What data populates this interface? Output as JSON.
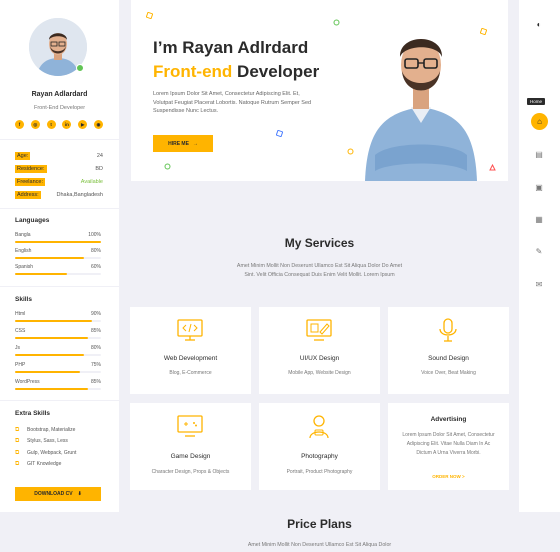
{
  "profile": {
    "name": "Rayan Adlardard",
    "role": "Front-End Developer",
    "socials": [
      "facebook-icon",
      "instagram-icon",
      "twitter-icon",
      "linkedin-icon",
      "youtube-icon",
      "dribbble-icon"
    ],
    "info": [
      {
        "key": "Age:",
        "value": "24",
        "status": ""
      },
      {
        "key": "Residence:",
        "value": "BD",
        "status": ""
      },
      {
        "key": "Freelance:",
        "value": "Available",
        "status": "green"
      },
      {
        "key": "Address:",
        "value": "Dhaka,Bangladesh",
        "status": ""
      }
    ]
  },
  "languages": {
    "title": "Languages",
    "items": [
      {
        "label": "Bangla",
        "value": "100%",
        "percent": 100
      },
      {
        "label": "English",
        "value": "80%",
        "percent": 80
      },
      {
        "label": "Spanish",
        "value": "60%",
        "percent": 60
      }
    ]
  },
  "skills": {
    "title": "Skills",
    "items": [
      {
        "label": "Html",
        "value": "90%",
        "percent": 90
      },
      {
        "label": "CSS",
        "value": "85%",
        "percent": 85
      },
      {
        "label": "Js",
        "value": "80%",
        "percent": 80
      },
      {
        "label": "PHP",
        "value": "75%",
        "percent": 75
      },
      {
        "label": "WordPress",
        "value": "85%",
        "percent": 85
      }
    ]
  },
  "extra_skills": {
    "title": "Extra Skills",
    "items": [
      "Bootstrap, Materialize",
      "Stylus, Sass, Less",
      "Gulp, Webpack, Grunt",
      "GIT Knowledge"
    ]
  },
  "download_cv": "DOWNLOAD CV",
  "hero": {
    "line1": "I’m Rayan Adlrdard",
    "line2_accent": "Front-end",
    "line2_rest": " Developer",
    "paragraph": "Lorem Ipsum Dolor Sit Amet, Consectetur Adipiscing Elit. Et, Volutpat Feugiat Placerat Lobortis. Natoque Rutrum Semper Sed Suspendisse Nunc Lectus.",
    "hire_label": "HIRE ME"
  },
  "rail": {
    "tooltip": "Home",
    "icons": [
      "theme-toggle-icon",
      "home-icon",
      "resume-icon",
      "profile-icon",
      "portfolio-icon",
      "blog-icon",
      "contact-icon"
    ]
  },
  "services": {
    "title": "My Services",
    "subtitle": "Amet Minim Mollit Non Deserunt Ullamco Est Sit Aliqua Dolor Do Amet Sint. Velit Officia Consequat Duis Enim Velit Mollit. Lorem Ipsum",
    "cards": [
      {
        "title": "Web Development",
        "sub": "Blog, E-Commerce",
        "icon": "web-development-icon"
      },
      {
        "title": "UI/UX Design",
        "sub": "Mobile App, Website Design",
        "icon": "ui-ux-design-icon"
      },
      {
        "title": "Sound Design",
        "sub": "Voice Over, Beat Making",
        "icon": "microphone-icon"
      },
      {
        "title": "Game Design",
        "sub": "Character Design, Props & Objects",
        "icon": "game-design-icon"
      },
      {
        "title": "Photography",
        "sub": "Portrait, Product Photography",
        "icon": "photography-icon"
      }
    ],
    "advertising": {
      "title": "Advertising",
      "text": "Lorem Ipsum Dolor Sit Amet, Consectetur Adipiscing Elit. Vitae Nulla Diam In Ac Dictum A Urna Viverra Morbi.",
      "link": "ORDER NOW >"
    }
  },
  "price": {
    "title": "Price Plans",
    "subtitle": "Amet Minim Mollit Non Deserunt Ullamco Est Sit Aliqua Dolor"
  },
  "colors": {
    "accent": "#ffb400",
    "background": "#f0f0f6",
    "text": "#2b2b2b"
  }
}
